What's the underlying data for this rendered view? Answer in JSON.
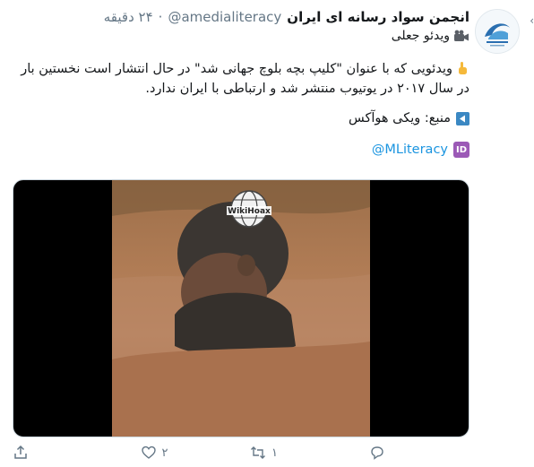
{
  "tweet": {
    "display_name": "انجمن سواد رسانه ای ایران",
    "handle": "@amedialiteracy",
    "separator": "·",
    "time": "۲۴ دقیقه",
    "subtitle": "ویدئو جعلی",
    "body": "ویدئویی که با عنوان \"کلیپ بچه بلوچ جهانی شد\" در حال انتشار است نخستین بار در سال ۲۰۱۷ در یوتیوب منتشر شد و  ارتباطی با  ایران ندارد.",
    "source_label": "منبع: ویکی هوآکس",
    "mention": "@MLiteracy",
    "id_badge": "ID",
    "caret": "›",
    "watermark_text": "WikiHoax"
  },
  "actions": {
    "reply_count": "",
    "retweet_count": "۱",
    "like_count": "۲",
    "share_count": ""
  },
  "icons": {
    "avatar": "media-literacy-logo-icon",
    "camera": "movie-camera-icon",
    "pointer": "pointing-finger-icon",
    "source": "blue-arrow-icon",
    "mention": "id-badge-icon",
    "reply": "reply-icon",
    "retweet": "retweet-icon",
    "like": "heart-icon",
    "share": "share-icon"
  },
  "colors": {
    "link": "#1b95e0",
    "muted": "#657786",
    "text": "#14171a"
  }
}
